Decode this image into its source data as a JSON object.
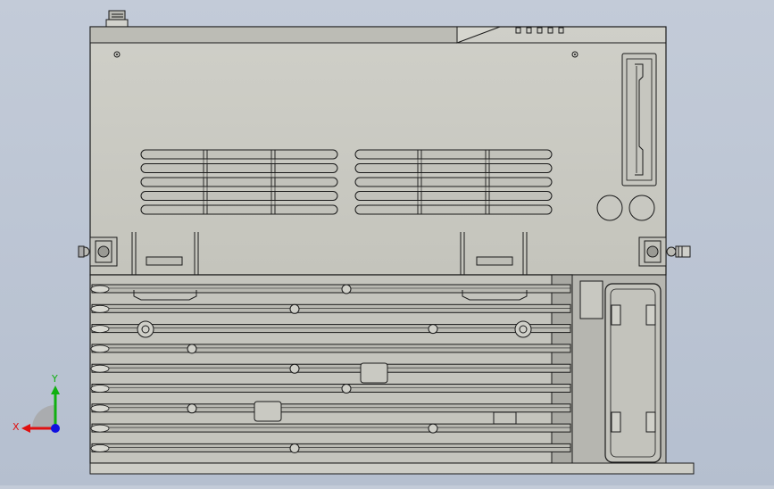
{
  "view": {
    "background_top": "#c3cbd8",
    "background_bottom": "#b5bfcf",
    "body_color": "#c8c8c0",
    "edge_color": "#1a1a1a",
    "heatsink_color": "#a8a8a2"
  },
  "triad": {
    "x_label": "X",
    "y_label": "Y",
    "x_color": "#e01010",
    "y_color": "#10b010",
    "z_color": "#1010e0"
  },
  "model": {
    "name": "",
    "vents_left_rows": 5,
    "vents_right_rows": 5,
    "heatsink_fins": 9
  }
}
